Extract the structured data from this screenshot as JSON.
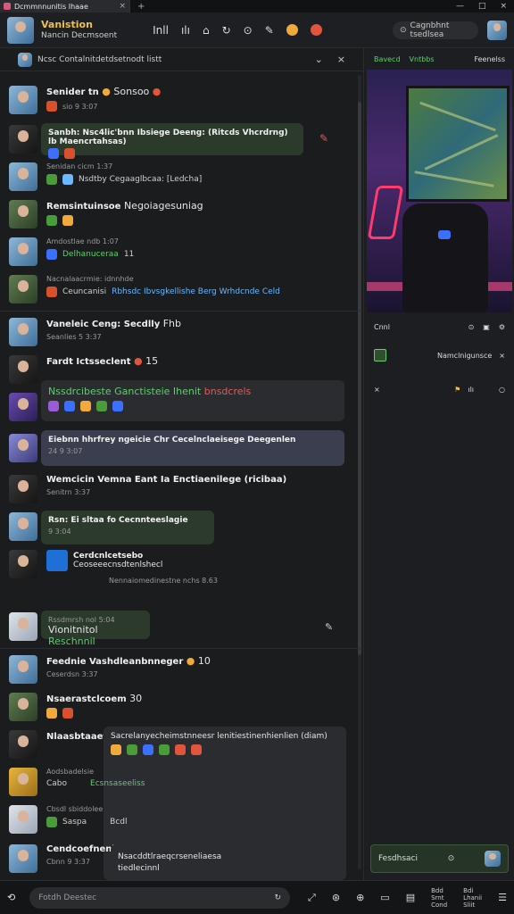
{
  "window": {
    "tab_title": "Dcmmnnunitis Ihaae",
    "tab_close": "×",
    "new_tab": "+",
    "controls": [
      "—",
      "□",
      "×"
    ]
  },
  "header": {
    "title": "Vanistion",
    "subtitle": "Nancin Decmsoent",
    "icons": [
      "Inll",
      "ılı",
      "⌂",
      "↻",
      "⊙",
      "✎"
    ],
    "search_label": "Cagnbhnt tsedlsea"
  },
  "thread": {
    "title": "Ncsc Contalnitdetdsetnodt listt",
    "collapse": "⌄",
    "close": "×"
  },
  "messages": [
    {
      "name": "Senider tn",
      "emoji_text": "Sonsoo",
      "meta": "sio 9 3:07"
    },
    {
      "text": "Sanbh: Nsc4lic'bnn Ibsiege Deeng: (Ritcds Vhcrdrng) lb Maencrtahsas)"
    },
    {
      "meta": "Senidan cicm 1:37",
      "text": "Nsdtby Cegaaglbcaa: [Ledcha]"
    },
    {
      "name": "Remsintuinsoe",
      "text": "Negoiagesuniag"
    },
    {
      "meta": "Amdostlae ndb 1:07",
      "text": "Delhanuceraa",
      "count": "11"
    },
    {
      "meta": "Nacnalaacrmie: idnnhde",
      "text": "Ceuncanisi",
      "link": "Rbhsdc Ibvsgkellishe Berg Wrhdcnde Celd"
    },
    {
      "name": "Vaneleic Ceng: Secdlly",
      "extra": "Fhb",
      "meta": "Seanlies 5 3:37"
    },
    {
      "name": "Fardt Ictsseclent",
      "count": "15"
    },
    {
      "text": "Nssdrcibeste Ganctisteie Ihenit",
      "text_red": "bnsdcrels"
    },
    {
      "text": "Eiebnn hhrfrey ngeicie Chr Cecelnclaeisege Deegenlen",
      "meta": "24 9 3:07"
    },
    {
      "name": "Wemcicin Vemna Eant Ia Enctiaenilege (ricibaa)",
      "meta": "Senitrn 3:37"
    },
    {
      "text": "Rsn: Ei sltaa fo Cecnnteeslagie",
      "meta": "9 3:04"
    },
    {
      "name": "Cerdcnlcetsebo",
      "text": "Ceoseeecnsdtenlshecl",
      "meta": "Nennaiomedinestne nchs 8.63"
    },
    {
      "meta": "Rssdmrsh nol 5:04",
      "text": "Vionitnitol",
      "link": "Reschnnil"
    },
    {
      "name": "Feednie Vashdleanbnneger",
      "count": "10",
      "meta": "Ceserdsn 3:37"
    },
    {
      "name": "Nsaerastclcoem",
      "count": "30"
    },
    {
      "name": "Nlaasbtaaeti",
      "text": "Sacrelanyecheimstnneesr lenitiestinenhienlien (diam)"
    },
    {
      "meta": "Aodsbadelsie",
      "text": "Cabo",
      "link": "Ecsnsaseeliss"
    },
    {
      "meta": "Cbsdl sbiddolee",
      "text": "Saspa",
      "extra": "Bcdl"
    },
    {
      "name": "Cendcoefnenitser",
      "text": "Nsacddtlraeqcrseneliaesa tiedlecinnl",
      "meta": "Cbnn 9 3:37"
    }
  ],
  "side": {
    "tabs": [
      "Bavecd",
      "Vntbbs",
      "Feenelss"
    ],
    "stream_label": "Cnnl",
    "row2_label": "Namclnigunsce",
    "input_label": "Fesdhsaci"
  },
  "bottom": {
    "back": "⟲",
    "compose_placeholder": "Fotdh Deestec",
    "compose_icon": "↻",
    "right_stack": [
      "Bdd",
      "Srnt",
      "Cond"
    ],
    "right_stack2": [
      "Bdi",
      "Lhanii",
      "Sliit"
    ]
  },
  "colors": {
    "accent_green": "#5fcf6f",
    "accent_gold": "#f0c24a",
    "bg": "#1b1c1e"
  }
}
